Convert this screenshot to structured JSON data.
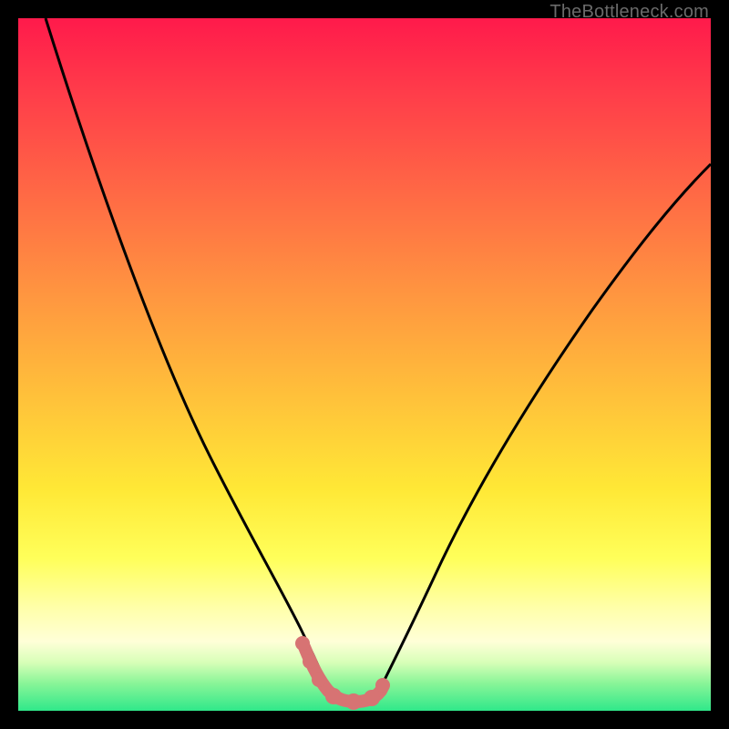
{
  "watermark": "TheBottleneck.com",
  "colors": {
    "curve_black": "#000000",
    "curve_pink": "#d77373",
    "bg_top": "#ff1a4b",
    "bg_bottom": "#2fe88a"
  },
  "chart_data": {
    "type": "line",
    "title": "",
    "xlabel": "",
    "ylabel": "",
    "xlim": [
      0,
      100
    ],
    "ylim": [
      0,
      100
    ],
    "series": [
      {
        "name": "left-curve",
        "x": [
          4,
          10,
          18,
          24,
          30,
          34,
          37,
          40,
          42,
          44
        ],
        "y": [
          100,
          78,
          55,
          40,
          26,
          17,
          11,
          7,
          4,
          2
        ]
      },
      {
        "name": "valley-floor",
        "x": [
          44,
          46,
          48,
          50,
          52
        ],
        "y": [
          2,
          1,
          1,
          1,
          2
        ]
      },
      {
        "name": "right-curve",
        "x": [
          52,
          55,
          60,
          66,
          74,
          84,
          94,
          100
        ],
        "y": [
          2,
          5,
          11,
          19,
          30,
          45,
          60,
          69
        ]
      },
      {
        "name": "valley-highlight",
        "x": [
          40,
          42,
          44,
          46,
          48,
          50,
          52
        ],
        "y": [
          7,
          4,
          2,
          1,
          1,
          1,
          2
        ]
      }
    ]
  }
}
